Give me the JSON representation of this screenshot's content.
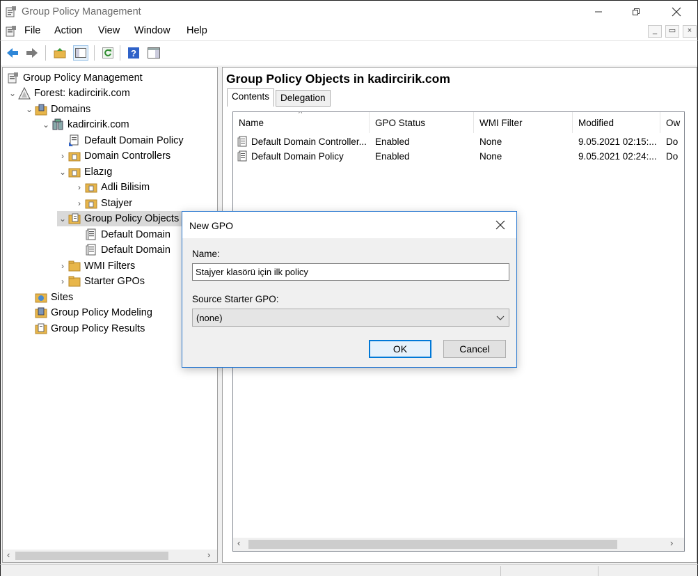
{
  "window": {
    "title": "Group Policy Management",
    "icon": "gpmc-app-icon"
  },
  "menu": {
    "items": [
      "File",
      "Action",
      "View",
      "Window",
      "Help"
    ]
  },
  "toolbar": {
    "icons": [
      "back-arrow-icon",
      "forward-arrow-icon",
      "up-folder-icon",
      "show-hide-console-tree-icon",
      "refresh-icon",
      "help-icon",
      "show-action-pane-icon"
    ]
  },
  "tree": {
    "items": [
      {
        "label": "Group Policy Management",
        "icon": "gpmc-icon"
      },
      {
        "label": "Forest: kadircirik.com",
        "icon": "forest-icon"
      },
      {
        "label": "Domains",
        "icon": "domains-icon"
      },
      {
        "label": "kadircirik.com",
        "icon": "domain-icon"
      },
      {
        "label": "Default Domain Policy",
        "icon": "gpo-link-icon"
      },
      {
        "label": "Domain Controllers",
        "icon": "ou-folder-icon"
      },
      {
        "label": "Elazıg",
        "icon": "ou-folder-icon"
      },
      {
        "label": "Adli Bilisim",
        "icon": "ou-folder-icon"
      },
      {
        "label": "Stajyer",
        "icon": "ou-folder-icon"
      },
      {
        "label": "Group Policy Objects",
        "icon": "gpo-container-icon"
      },
      {
        "label": "Default Domain",
        "icon": "gpo-icon"
      },
      {
        "label": "Default Domain",
        "icon": "gpo-icon"
      },
      {
        "label": "WMI Filters",
        "icon": "folder-icon"
      },
      {
        "label": "Starter GPOs",
        "icon": "folder-icon"
      },
      {
        "label": "Sites",
        "icon": "sites-icon"
      },
      {
        "label": "Group Policy Modeling",
        "icon": "modeling-icon"
      },
      {
        "label": "Group Policy Results",
        "icon": "results-icon"
      }
    ]
  },
  "right_pane": {
    "title": "Group Policy Objects in kadircirik.com",
    "tabs": [
      "Contents",
      "Delegation"
    ],
    "columns": [
      "Name",
      "GPO Status",
      "WMI Filter",
      "Modified",
      "Ow"
    ],
    "rows": [
      {
        "name": "Default Domain Controller...",
        "status": "Enabled",
        "wmi": "None",
        "modified": "9.05.2021 02:15:...",
        "owner": "Do"
      },
      {
        "name": "Default Domain Policy",
        "status": "Enabled",
        "wmi": "None",
        "modified": "9.05.2021 02:24:...",
        "owner": "Do"
      }
    ]
  },
  "dialog": {
    "title": "New GPO",
    "name_label": "Name:",
    "name_value": "Stajyer klasörü için ilk policy",
    "source_label": "Source Starter GPO:",
    "source_value": "(none)",
    "ok_label": "OK",
    "cancel_label": "Cancel"
  },
  "colors": {
    "accent": "#0078d7",
    "dialog_border": "#2b79d0",
    "selected_bg": "#d9d9d9"
  }
}
